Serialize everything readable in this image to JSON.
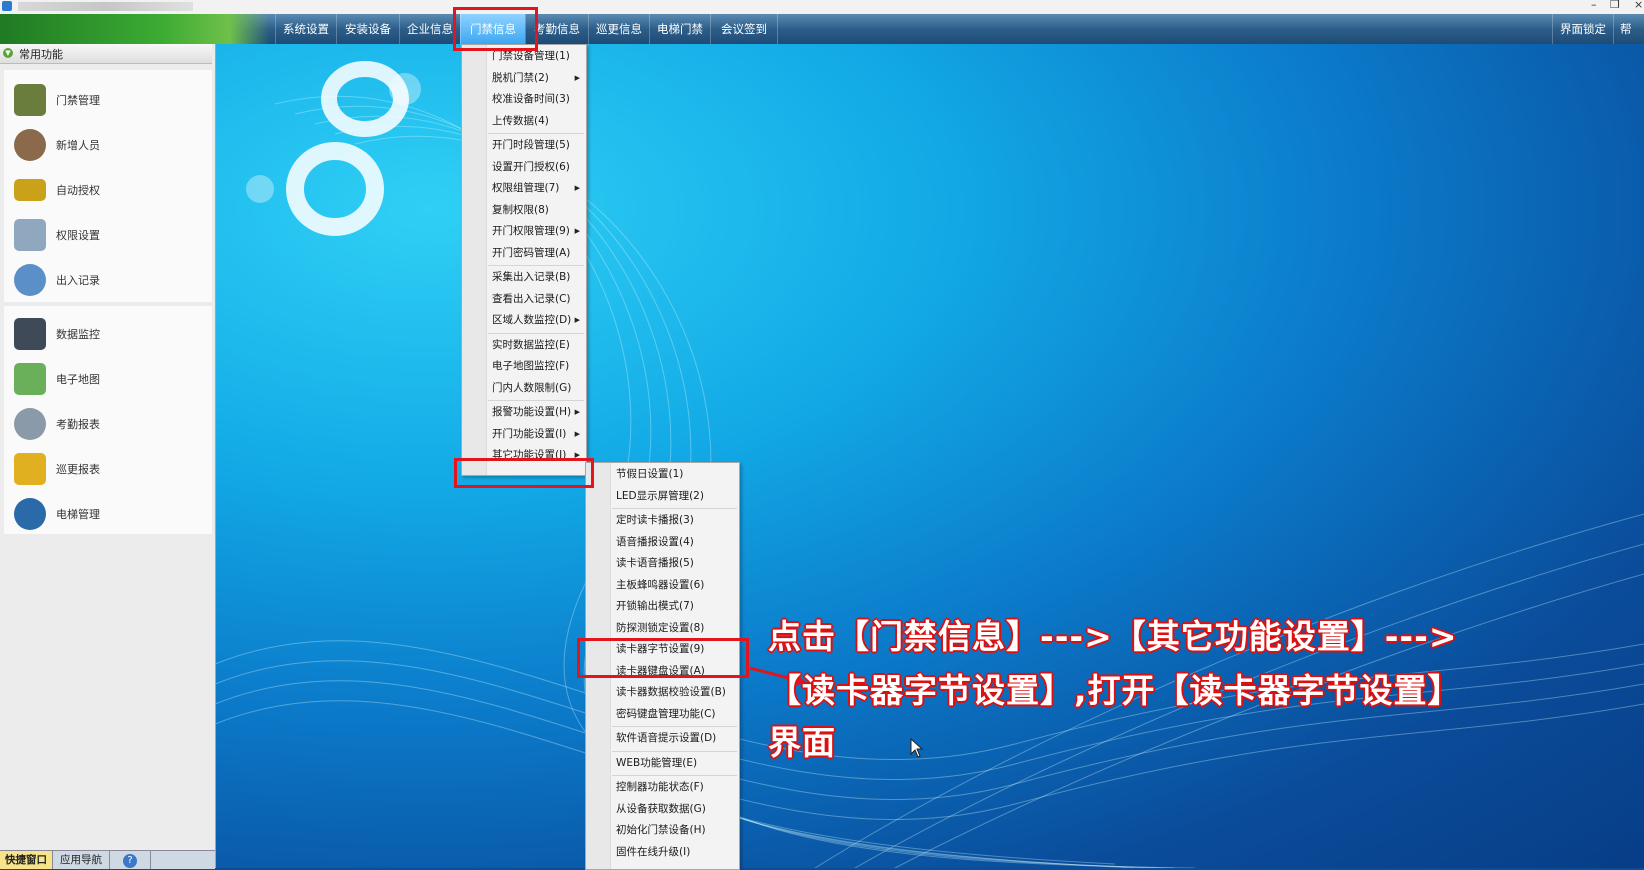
{
  "menubar": {
    "items": [
      "系统设置",
      "安装设备",
      "企业信息",
      "门禁信息",
      "考勤信息",
      "巡更信息",
      "电梯门禁",
      "会议签到"
    ],
    "right_items": [
      "界面锁定",
      "帮"
    ]
  },
  "sidebar": {
    "header": "常用功能",
    "group1": [
      {
        "label": "门禁管理",
        "icon": "door-control-icon",
        "color": "#6a7d3c"
      },
      {
        "label": "新增人员",
        "icon": "person-icon",
        "color": "#8a6a4a"
      },
      {
        "label": "自动授权",
        "icon": "card-icon",
        "color": "#c9a21a"
      },
      {
        "label": "权限设置",
        "icon": "calendar-clock-icon",
        "color": "#8fa8c0"
      },
      {
        "label": "出入记录",
        "icon": "magnifier-icon",
        "color": "#5b8fc8"
      }
    ],
    "group2": [
      {
        "label": "数据监控",
        "icon": "camera-icon",
        "color": "#3e4a58"
      },
      {
        "label": "电子地图",
        "icon": "map-icon",
        "color": "#6ab05a"
      },
      {
        "label": "考勤报表",
        "icon": "clock-icon",
        "color": "#8a9aa8"
      },
      {
        "label": "巡更报表",
        "icon": "layers-icon",
        "color": "#e0b020"
      },
      {
        "label": "电梯管理",
        "icon": "elevator-icon",
        "color": "#2a6aa8"
      }
    ],
    "bottom_tabs": [
      "快捷窗口",
      "应用导航",
      "?"
    ]
  },
  "menu_main": [
    {
      "label": "门禁设备管理(1)",
      "arrow": false,
      "sep_after": false
    },
    {
      "label": "脱机门禁(2)",
      "arrow": true,
      "sep_after": false
    },
    {
      "label": "校准设备时间(3)",
      "arrow": false,
      "sep_after": false
    },
    {
      "label": "上传数据(4)",
      "arrow": false,
      "sep_after": true
    },
    {
      "label": "开门时段管理(5)",
      "arrow": false,
      "sep_after": false
    },
    {
      "label": "设置开门授权(6)",
      "arrow": false,
      "sep_after": false
    },
    {
      "label": "权限组管理(7)",
      "arrow": true,
      "sep_after": false
    },
    {
      "label": "复制权限(8)",
      "arrow": false,
      "sep_after": false
    },
    {
      "label": "开门权限管理(9)",
      "arrow": true,
      "sep_after": false
    },
    {
      "label": "开门密码管理(A)",
      "arrow": false,
      "sep_after": true
    },
    {
      "label": "采集出入记录(B)",
      "arrow": false,
      "sep_after": false
    },
    {
      "label": "查看出入记录(C)",
      "arrow": false,
      "sep_after": false
    },
    {
      "label": "区域人数监控(D)",
      "arrow": true,
      "sep_after": true
    },
    {
      "label": "实时数据监控(E)",
      "arrow": false,
      "sep_after": false
    },
    {
      "label": "电子地图监控(F)",
      "arrow": false,
      "sep_after": false
    },
    {
      "label": "门内人数限制(G)",
      "arrow": false,
      "sep_after": true
    },
    {
      "label": "报警功能设置(H)",
      "arrow": true,
      "sep_after": false
    },
    {
      "label": "开门功能设置(I)",
      "arrow": true,
      "sep_after": false
    },
    {
      "label": "其它功能设置(J)",
      "arrow": true,
      "sep_after": false
    }
  ],
  "menu_sub": [
    {
      "label": "节假日设置(1)",
      "sep_after": false
    },
    {
      "label": "LED显示屏管理(2)",
      "sep_after": true
    },
    {
      "label": "定时读卡播报(3)",
      "sep_after": false
    },
    {
      "label": "语音播报设置(4)",
      "sep_after": false
    },
    {
      "label": "读卡语音播报(5)",
      "sep_after": false
    },
    {
      "label": "主板蜂鸣器设置(6)",
      "sep_after": false
    },
    {
      "label": "开锁输出模式(7)",
      "sep_after": false
    },
    {
      "label": "防探测锁定设置(8)",
      "sep_after": false
    },
    {
      "label": "读卡器字节设置(9)",
      "sep_after": false
    },
    {
      "label": "读卡器键盘设置(A)",
      "sep_after": false
    },
    {
      "label": "读卡器数据校验设置(B)",
      "sep_after": false
    },
    {
      "label": "密码键盘管理功能(C)",
      "sep_after": true
    },
    {
      "label": "软件语音提示设置(D)",
      "sep_after": true
    },
    {
      "label": "WEB功能管理(E)",
      "sep_after": true
    },
    {
      "label": "控制器功能状态(F)",
      "sep_after": false
    },
    {
      "label": "从设备获取数据(G)",
      "sep_after": false
    },
    {
      "label": "初始化门禁设备(H)",
      "sep_after": false
    },
    {
      "label": "固件在线升级(I)",
      "sep_after": false
    }
  ],
  "annotation": {
    "line1": "点击【门禁信息】--->【其它功能设置】--->",
    "line2": "【读卡器字节设置】,打开【读卡器字节设置】",
    "line3": "界面"
  },
  "colors": {
    "highlight_red": "#e3141b",
    "active_menu": "#3da7f0"
  }
}
